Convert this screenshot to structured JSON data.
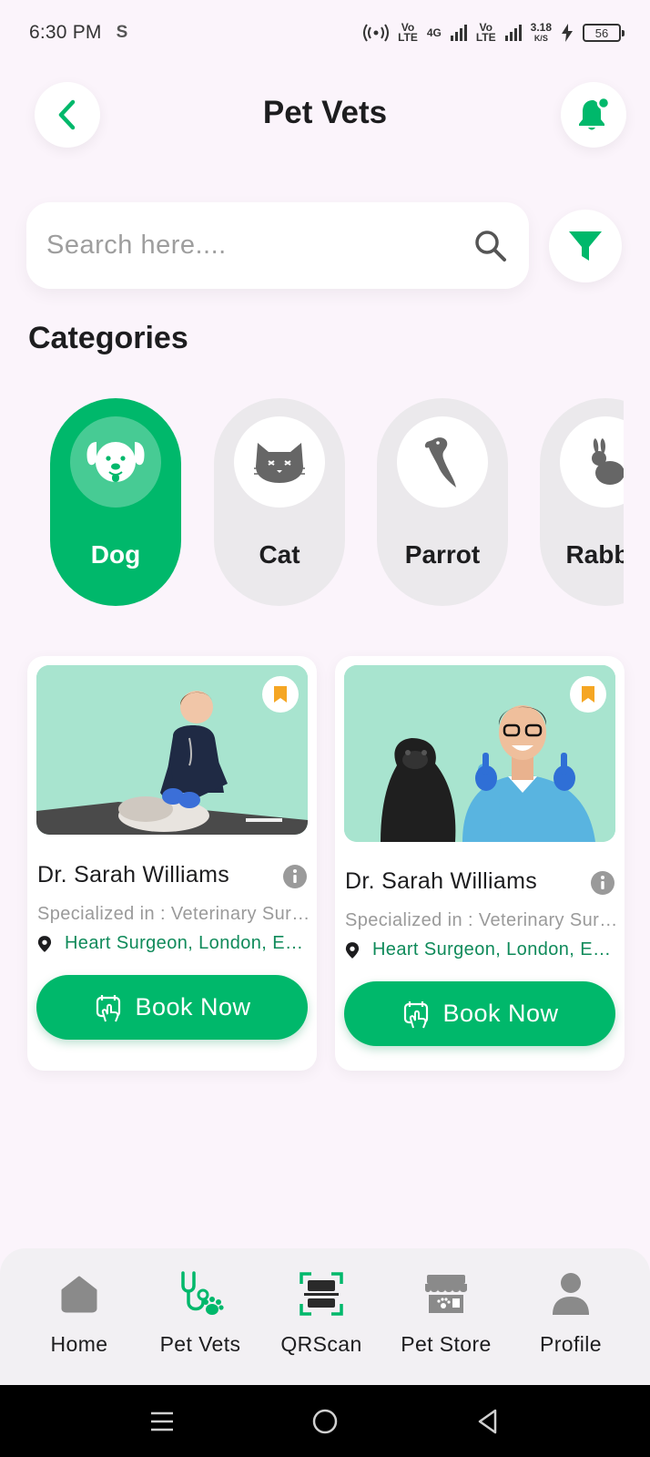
{
  "status_bar": {
    "time": "6:30 PM",
    "carrier_icon": "S",
    "signal1": "Vo\nLTE",
    "network": "4G",
    "signal2": "Vo\nLTE",
    "speed_value": "3.18",
    "speed_unit": "K/S",
    "battery": "56"
  },
  "header": {
    "title": "Pet Vets",
    "back_icon": "chevron-left-icon",
    "notification_icon": "bell-icon"
  },
  "search": {
    "placeholder": "Search here....",
    "value": ""
  },
  "categories": {
    "title": "Categories",
    "items": [
      {
        "label": "Dog",
        "icon": "dog-icon",
        "active": true
      },
      {
        "label": "Cat",
        "icon": "cat-icon",
        "active": false
      },
      {
        "label": "Parrot",
        "icon": "parrot-icon",
        "active": false
      },
      {
        "label": "Rabbit",
        "icon": "rabbit-icon",
        "active": false
      }
    ]
  },
  "vets": [
    {
      "name": "Dr. Sarah Williams",
      "specialization": "Specialized in : Veterinary Surgeon",
      "location": "Heart Surgeon, London, England",
      "button": "Book Now"
    },
    {
      "name": "Dr. Sarah Williams",
      "specialization": "Specialized in : Veterinary Surgeon",
      "location": "Heart Surgeon, London, England",
      "button": "Book Now"
    }
  ],
  "bottom_nav": {
    "items": [
      {
        "label": "Home",
        "icon": "home-icon"
      },
      {
        "label": "Pet Vets",
        "icon": "stethoscope-icon",
        "active": true
      },
      {
        "label": "QRScan",
        "icon": "qr-scan-icon"
      },
      {
        "label": "Pet Store",
        "icon": "store-icon"
      },
      {
        "label": "Profile",
        "icon": "profile-icon"
      }
    ]
  },
  "colors": {
    "accent": "#00b86b",
    "background": "#fbf4fb",
    "card_image_bg": "#a8e4cf",
    "bookmark": "#f5a623"
  }
}
